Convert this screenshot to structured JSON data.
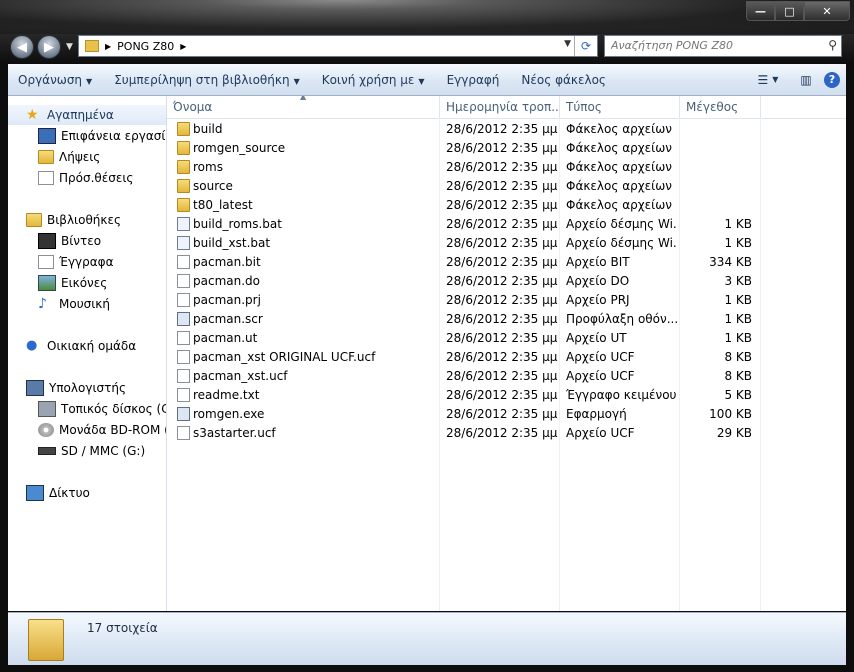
{
  "window": {
    "controls": {
      "minimize": "—",
      "maximize": "□",
      "close": "✕"
    }
  },
  "address_bar": {
    "breadcrumb": "PONG Z80"
  },
  "search": {
    "placeholder": "Αναζήτηση PONG Z80"
  },
  "toolbar": {
    "organize": "Οργάνωση",
    "include_in_library": "Συμπερίληψη στη βιβλιοθήκη",
    "share_with": "Κοινή χρήση με",
    "burn": "Εγγραφή",
    "new_folder": "Νέος φάκελος"
  },
  "nav": {
    "favorites": "Αγαπημένα",
    "desktop": "Επιφάνεια εργασίας",
    "downloads": "Λήψεις",
    "recent": "Πρόσ.θέσεις",
    "libraries": "Βιβλιοθήκες",
    "videos": "Βίντεο",
    "documents": "Έγγραφα",
    "pictures": "Εικόνες",
    "music": "Μουσική",
    "homegroup": "Οικιακή ομάδα",
    "computer": "Υπολογιστής",
    "local_disk": "Τοπικός δίσκος (C:)",
    "bd_rom": "Μονάδα BD-ROM (F",
    "sd_mmc": "SD / MMC (G:)",
    "network": "Δίκτυο"
  },
  "columns": {
    "name": "Όνομα",
    "date": "Ημερομηνία τροπ...",
    "type": "Τύπος",
    "size": "Μέγεθος"
  },
  "files": [
    {
      "name": "build",
      "date": "28/6/2012 2:35 μμ",
      "type": "Φάκελος αρχείων",
      "size": "",
      "icon": "folder-icon"
    },
    {
      "name": "romgen_source",
      "date": "28/6/2012 2:35 μμ",
      "type": "Φάκελος αρχείων",
      "size": "",
      "icon": "folder-icon"
    },
    {
      "name": "roms",
      "date": "28/6/2012 2:35 μμ",
      "type": "Φάκελος αρχείων",
      "size": "",
      "icon": "folder-icon"
    },
    {
      "name": "source",
      "date": "28/6/2012 2:35 μμ",
      "type": "Φάκελος αρχείων",
      "size": "",
      "icon": "folder-icon"
    },
    {
      "name": "t80_latest",
      "date": "28/6/2012 2:35 μμ",
      "type": "Φάκελος αρχείων",
      "size": "",
      "icon": "folder-icon"
    },
    {
      "name": "build_roms.bat",
      "date": "28/6/2012 2:35 μμ",
      "type": "Αρχείο δέσμης Wi...",
      "size": "1 KB",
      "icon": "batch-file-icon"
    },
    {
      "name": "build_xst.bat",
      "date": "28/6/2012 2:35 μμ",
      "type": "Αρχείο δέσμης Wi...",
      "size": "1 KB",
      "icon": "batch-file-icon"
    },
    {
      "name": "pacman.bit",
      "date": "28/6/2012 2:35 μμ",
      "type": "Αρχείο BIT",
      "size": "334 KB",
      "icon": "file-icon"
    },
    {
      "name": "pacman.do",
      "date": "28/6/2012 2:35 μμ",
      "type": "Αρχείο DO",
      "size": "3 KB",
      "icon": "file-icon"
    },
    {
      "name": "pacman.prj",
      "date": "28/6/2012 2:35 μμ",
      "type": "Αρχείο PRJ",
      "size": "1 KB",
      "icon": "file-icon"
    },
    {
      "name": "pacman.scr",
      "date": "28/6/2012 2:35 μμ",
      "type": "Προφύλαξη οθόν...",
      "size": "1 KB",
      "icon": "screensaver-icon"
    },
    {
      "name": "pacman.ut",
      "date": "28/6/2012 2:35 μμ",
      "type": "Αρχείο UT",
      "size": "1 KB",
      "icon": "file-icon"
    },
    {
      "name": "pacman_xst ORIGINAL UCF.ucf",
      "date": "28/6/2012 2:35 μμ",
      "type": "Αρχείο UCF",
      "size": "8 KB",
      "icon": "file-icon"
    },
    {
      "name": "pacman_xst.ucf",
      "date": "28/6/2012 2:35 μμ",
      "type": "Αρχείο UCF",
      "size": "8 KB",
      "icon": "file-icon"
    },
    {
      "name": "readme.txt",
      "date": "28/6/2012 2:35 μμ",
      "type": "Έγγραφο κειμένου",
      "size": "5 KB",
      "icon": "text-file-icon"
    },
    {
      "name": "romgen.exe",
      "date": "28/6/2012 2:35 μμ",
      "type": "Εφαρμογή",
      "size": "100 KB",
      "icon": "application-icon"
    },
    {
      "name": "s3astarter.ucf",
      "date": "28/6/2012 2:35 μμ",
      "type": "Αρχείο UCF",
      "size": "29 KB",
      "icon": "file-icon"
    }
  ],
  "status": {
    "item_count": "17 στοιχεία"
  },
  "colors": {
    "toolbar_text": "#1e395b",
    "column_header_text": "#4c607a",
    "folder_yellow": "#e2b63c"
  }
}
